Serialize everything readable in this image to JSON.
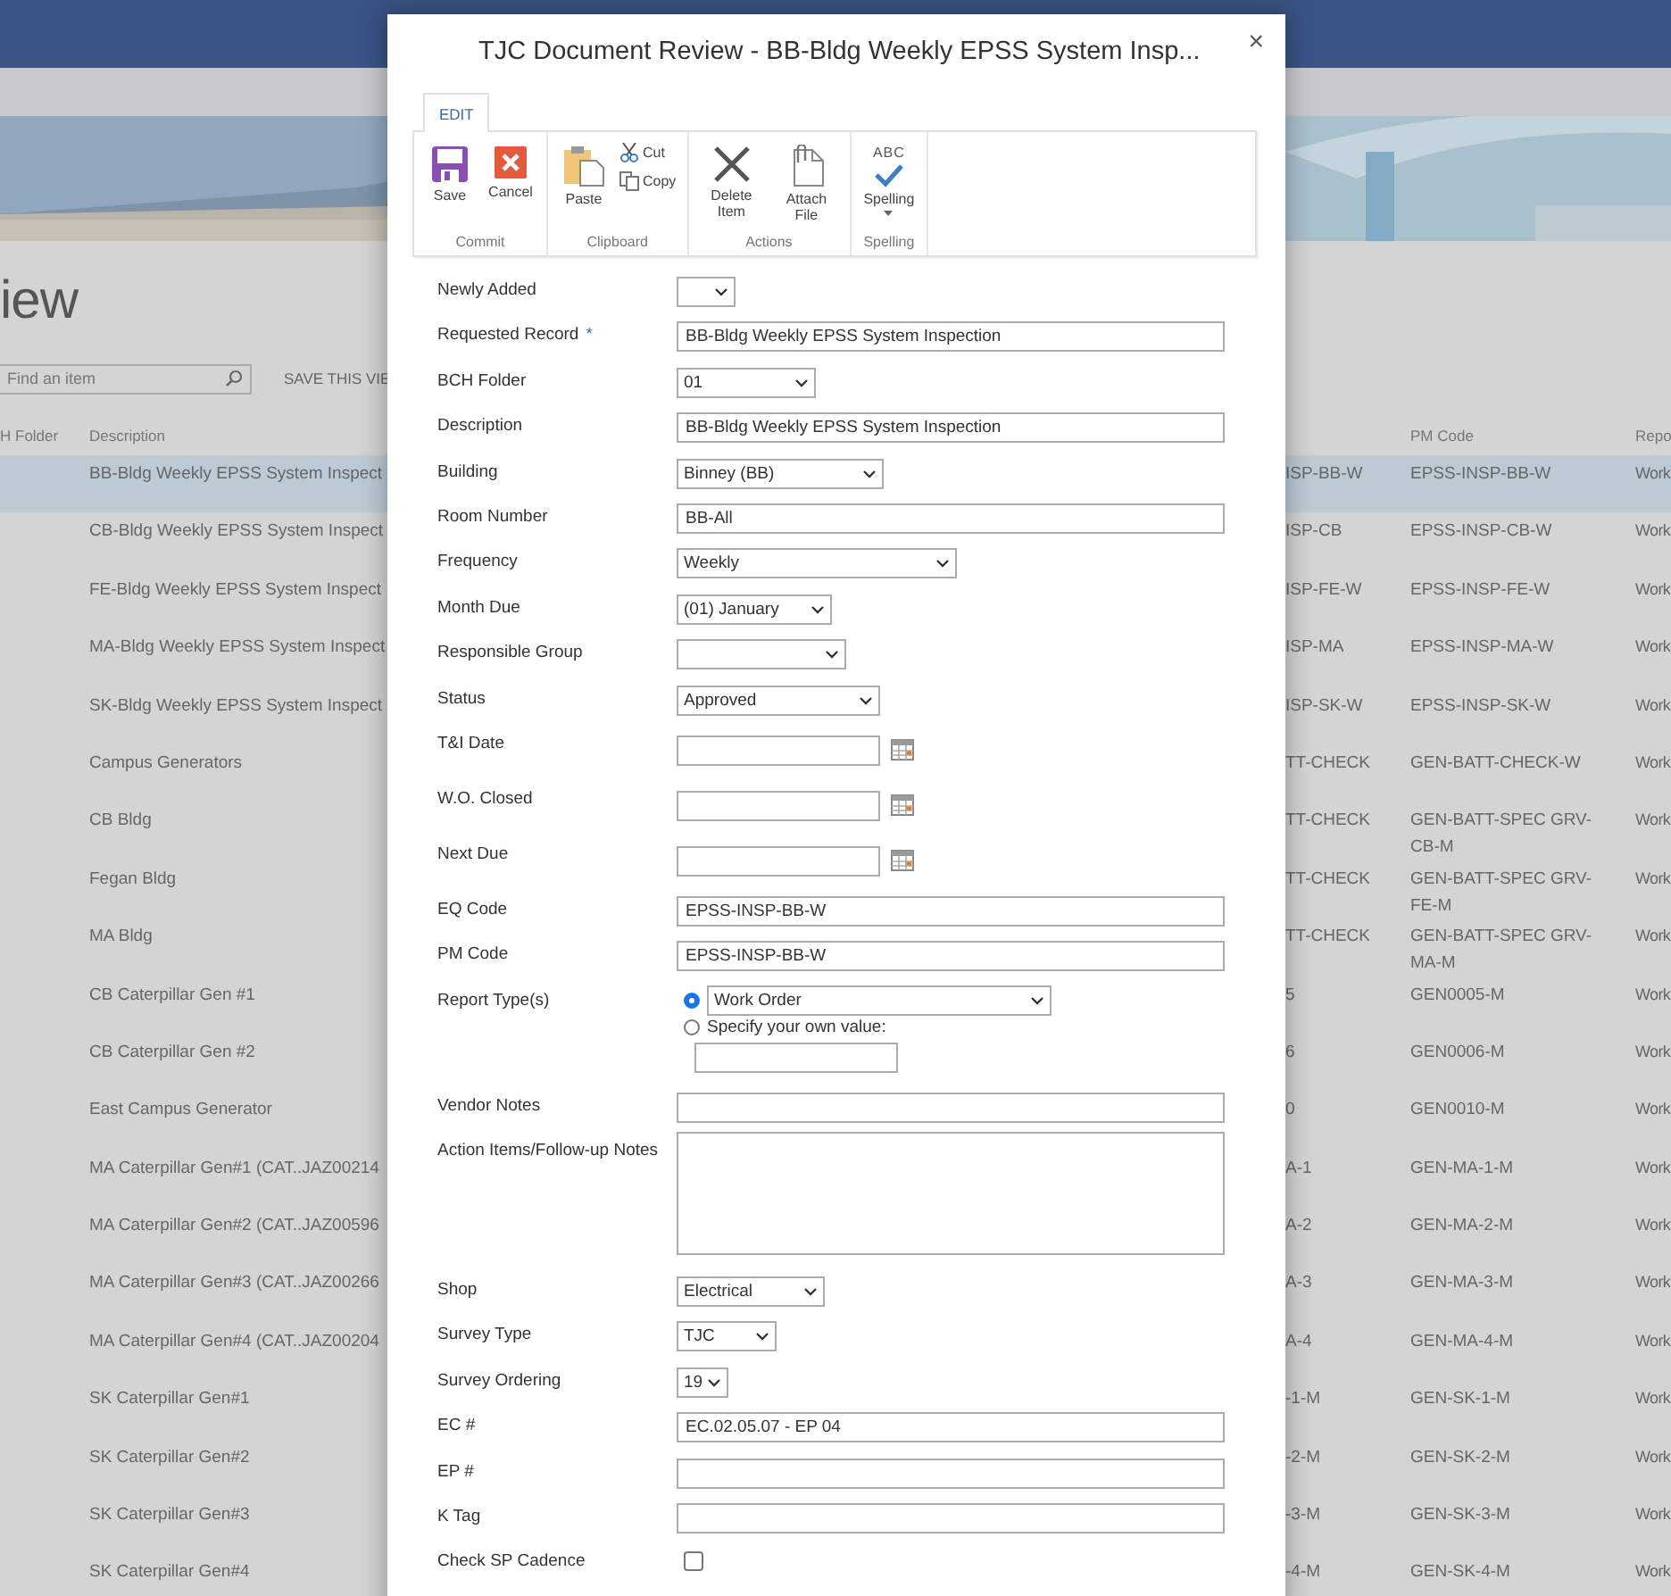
{
  "background_page": {
    "heading": "iew",
    "search": {
      "placeholder": "Find an item"
    },
    "save_view": "SAVE THIS VIE",
    "columns": [
      "H Folder",
      "Description",
      "",
      "PM Code",
      "Repo"
    ],
    "rows": [
      {
        "description": "BB-Bldg Weekly EPSS System Inspect",
        "eq_code": "ISP-BB-W",
        "pm_code": "EPSS-INSP-BB-W",
        "report": "Work",
        "selected": true
      },
      {
        "description": "CB-Bldg Weekly EPSS System Inspect",
        "eq_code": "ISP-CB",
        "pm_code": "EPSS-INSP-CB-W",
        "report": "Work",
        "selected": false
      },
      {
        "description": "FE-Bldg Weekly EPSS System Inspect",
        "eq_code": "ISP-FE-W",
        "pm_code": "EPSS-INSP-FE-W",
        "report": "Work",
        "selected": false
      },
      {
        "description": "MA-Bldg Weekly EPSS System Inspect",
        "eq_code": "ISP-MA",
        "pm_code": "EPSS-INSP-MA-W",
        "report": "Work",
        "selected": false
      },
      {
        "description": "SK-Bldg Weekly EPSS System Inspect",
        "eq_code": "ISP-SK-W",
        "pm_code": "EPSS-INSP-SK-W",
        "report": "Work",
        "selected": false
      },
      {
        "description": "Campus Generators",
        "eq_code": "TT-CHECK",
        "pm_code": "GEN-BATT-CHECK-W",
        "report": "Work",
        "selected": false
      },
      {
        "description": "CB Bldg",
        "eq_code": "TT-CHECK",
        "pm_code": "GEN-BATT-SPEC GRV-CB-M",
        "report": "Work",
        "selected": false
      },
      {
        "description": "Fegan Bldg",
        "eq_code": "TT-CHECK",
        "pm_code": "GEN-BATT-SPEC GRV-FE-M",
        "report": "Work",
        "selected": false
      },
      {
        "description": "MA Bldg",
        "eq_code": "TT-CHECK",
        "pm_code": "GEN-BATT-SPEC GRV-MA-M",
        "report": "Work",
        "selected": false
      },
      {
        "description": "CB Caterpillar Gen #1",
        "eq_code": "5",
        "pm_code": "GEN0005-M",
        "report": "Work",
        "selected": false
      },
      {
        "description": "CB Caterpillar Gen #2",
        "eq_code": "6",
        "pm_code": "GEN0006-M",
        "report": "Work",
        "selected": false
      },
      {
        "description": "East Campus Generator",
        "eq_code": "0",
        "pm_code": "GEN0010-M",
        "report": "Work",
        "selected": false
      },
      {
        "description": "MA Caterpillar Gen#1 (CAT..JAZ00214",
        "eq_code": "A-1",
        "pm_code": "GEN-MA-1-M",
        "report": "Work",
        "selected": false
      },
      {
        "description": "MA Caterpillar Gen#2 (CAT..JAZ00596",
        "eq_code": "A-2",
        "pm_code": "GEN-MA-2-M",
        "report": "Work",
        "selected": false
      },
      {
        "description": "MA Caterpillar Gen#3 (CAT..JAZ00266",
        "eq_code": "A-3",
        "pm_code": "GEN-MA-3-M",
        "report": "Work",
        "selected": false
      },
      {
        "description": "MA Caterpillar Gen#4 (CAT..JAZ00204",
        "eq_code": "A-4",
        "pm_code": "GEN-MA-4-M",
        "report": "Work",
        "selected": false
      },
      {
        "description": "SK Caterpillar Gen#1",
        "eq_code": "-1-M",
        "pm_code": "GEN-SK-1-M",
        "report": "Work",
        "selected": false
      },
      {
        "description": "SK Caterpillar Gen#2",
        "eq_code": "-2-M",
        "pm_code": "GEN-SK-2-M",
        "report": "Work",
        "selected": false
      },
      {
        "description": "SK Caterpillar Gen#3",
        "eq_code": "-3-M",
        "pm_code": "GEN-SK-3-M",
        "report": "Work",
        "selected": false
      },
      {
        "description": "SK Caterpillar Gen#4",
        "eq_code": "-4-M",
        "pm_code": "GEN-SK-4-M",
        "report": "Work",
        "selected": false
      }
    ]
  },
  "dialog": {
    "title": "TJC Document Review - BB-Bldg Weekly EPSS System Insp...",
    "close": "×",
    "ribbon": {
      "tabs": [
        {
          "label": "EDIT",
          "selected": true
        }
      ],
      "groups": [
        {
          "label": "Commit",
          "buttons": [
            {
              "kind": "save",
              "label": "Save"
            },
            {
              "kind": "cancel",
              "label": "Cancel"
            }
          ]
        },
        {
          "label": "Clipboard",
          "buttons": [
            {
              "kind": "paste",
              "label": "Paste"
            },
            {
              "kind": "cut",
              "label": "Cut"
            },
            {
              "kind": "copy",
              "label": "Copy"
            }
          ]
        },
        {
          "label": "Actions",
          "buttons": [
            {
              "kind": "delete",
              "label": "Delete Item"
            },
            {
              "kind": "attach",
              "label": "Attach File"
            }
          ]
        },
        {
          "label": "Spelling",
          "buttons": [
            {
              "kind": "spelling",
              "label": "Spelling",
              "glyph": "ABC"
            }
          ]
        }
      ]
    },
    "form": {
      "fields": [
        {
          "label": "Newly Added",
          "kind": "dropdown"
        },
        {
          "label": "Requested Record",
          "kind": "text",
          "value": "BB-Bldg Weekly EPSS System Inspection",
          "required_mark": "*"
        },
        {
          "label": "BCH Folder",
          "kind": "dropdown",
          "value": "01"
        },
        {
          "label": "Description",
          "kind": "text",
          "value": "BB-Bldg Weekly EPSS System Inspection"
        },
        {
          "label": "Building",
          "kind": "dropdown",
          "value": "Binney (BB)"
        },
        {
          "label": "Room Number",
          "kind": "text",
          "value": "BB-All"
        },
        {
          "label": "Frequency",
          "kind": "dropdown",
          "value": "Weekly"
        },
        {
          "label": "Month Due",
          "kind": "dropdown",
          "value": "(01) January"
        },
        {
          "label": "Responsible Group",
          "kind": "dropdown"
        },
        {
          "label": "Status",
          "kind": "dropdown",
          "value": "Approved"
        },
        {
          "label": "T&I Date",
          "kind": "date"
        },
        {
          "label": "W.O. Closed",
          "kind": "date"
        },
        {
          "label": "Next Due",
          "kind": "date"
        },
        {
          "label": "EQ Code",
          "kind": "text",
          "value": "EPSS-INSP-BB-W"
        },
        {
          "label": "PM Code",
          "kind": "text",
          "value": "EPSS-INSP-BB-W"
        },
        {
          "label": "Report Type(s)",
          "kind": "radio",
          "options": [
            {
              "kind": "dropdown",
              "value": "Work Order",
              "selected": true
            },
            {
              "kind": "custom",
              "label": "Specify your own value:",
              "selected": false
            }
          ]
        },
        {
          "label": "Vendor Notes",
          "kind": "text"
        },
        {
          "label": "Action Items/Follow-up Notes",
          "kind": "textarea"
        },
        {
          "label": "Shop",
          "kind": "dropdown",
          "value": "Electrical"
        },
        {
          "label": "Survey Type",
          "kind": "dropdown",
          "value": "TJC"
        },
        {
          "label": "Survey Ordering",
          "kind": "dropdown",
          "value": "19"
        },
        {
          "label": "EC #",
          "kind": "text",
          "value": "EC.02.05.07 - EP 04"
        },
        {
          "label": "EP #",
          "kind": "text"
        },
        {
          "label": "K Tag",
          "kind": "text"
        },
        {
          "label": "Check SP Cadence",
          "kind": "checkbox",
          "checked": false
        }
      ]
    }
  }
}
